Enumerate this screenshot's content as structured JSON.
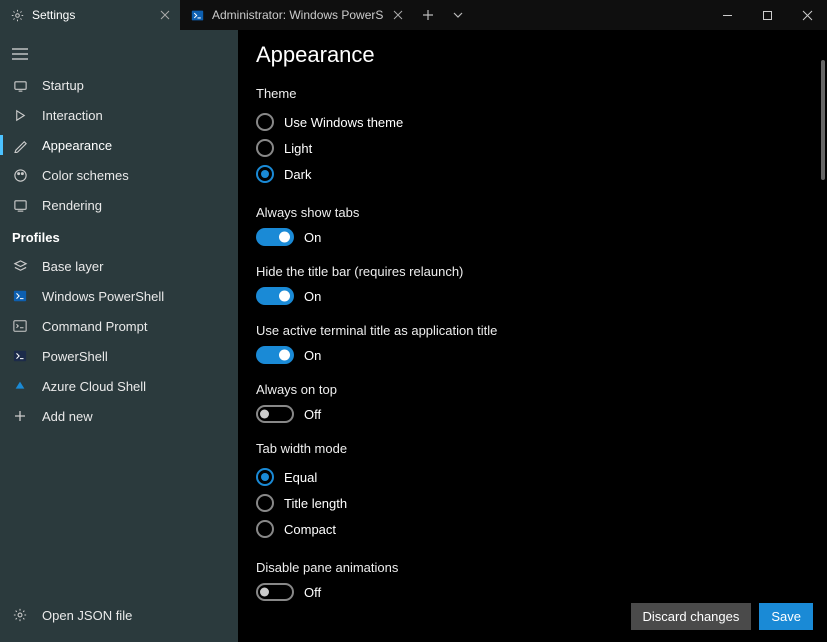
{
  "tabs": [
    {
      "label": "Settings",
      "active": true
    },
    {
      "label": "Administrator: Windows PowerS",
      "active": false
    }
  ],
  "sidebar": {
    "items": [
      {
        "label": "Startup"
      },
      {
        "label": "Interaction"
      },
      {
        "label": "Appearance"
      },
      {
        "label": "Color schemes"
      },
      {
        "label": "Rendering"
      }
    ],
    "profiles_header": "Profiles",
    "profiles": [
      {
        "label": "Base layer"
      },
      {
        "label": "Windows PowerShell"
      },
      {
        "label": "Command Prompt"
      },
      {
        "label": "PowerShell"
      },
      {
        "label": "Azure Cloud Shell"
      },
      {
        "label": "Add new"
      }
    ],
    "open_json": "Open JSON file"
  },
  "page": {
    "title": "Appearance",
    "theme": {
      "label": "Theme",
      "options": [
        "Use Windows theme",
        "Light",
        "Dark"
      ],
      "selected": "Dark"
    },
    "always_show_tabs": {
      "label": "Always show tabs",
      "value": "On",
      "on": true
    },
    "hide_title_bar": {
      "label": "Hide the title bar (requires relaunch)",
      "value": "On",
      "on": true
    },
    "use_active_title": {
      "label": "Use active terminal title as application title",
      "value": "On",
      "on": true
    },
    "always_on_top": {
      "label": "Always on top",
      "value": "Off",
      "on": false
    },
    "tab_width_mode": {
      "label": "Tab width mode",
      "options": [
        "Equal",
        "Title length",
        "Compact"
      ],
      "selected": "Equal"
    },
    "disable_pane_animations": {
      "label": "Disable pane animations",
      "value": "Off",
      "on": false
    }
  },
  "buttons": {
    "discard": "Discard changes",
    "save": "Save"
  }
}
